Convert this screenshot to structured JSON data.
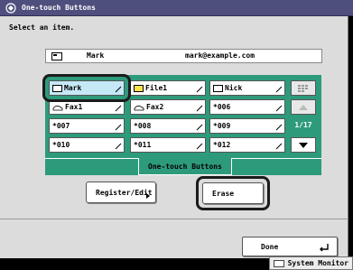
{
  "title": "One-touch Buttons",
  "instruction": "Select an item.",
  "selected_entry": {
    "name": "Mark",
    "address": "mark@example.com"
  },
  "grid": [
    [
      {
        "label": "Mark",
        "icon": "email"
      },
      {
        "label": "File1",
        "icon": "folder"
      },
      {
        "label": "Nick",
        "icon": "email"
      }
    ],
    [
      {
        "label": "Fax1",
        "icon": "fax"
      },
      {
        "label": "Fax2",
        "icon": "fax"
      },
      {
        "label": "*006",
        "icon": ""
      }
    ],
    [
      {
        "label": "*007",
        "icon": ""
      },
      {
        "label": "*008",
        "icon": ""
      },
      {
        "label": "*009",
        "icon": ""
      }
    ],
    [
      {
        "label": "*010",
        "icon": ""
      },
      {
        "label": "*011",
        "icon": ""
      },
      {
        "label": "*012",
        "icon": ""
      }
    ]
  ],
  "page_indicator": "1/17",
  "tab_label": "One-touch Buttons",
  "register_edit_label": "Register/Edit",
  "erase_label": "Erase",
  "done_label": "Done",
  "system_monitor_label": "System Monitor"
}
